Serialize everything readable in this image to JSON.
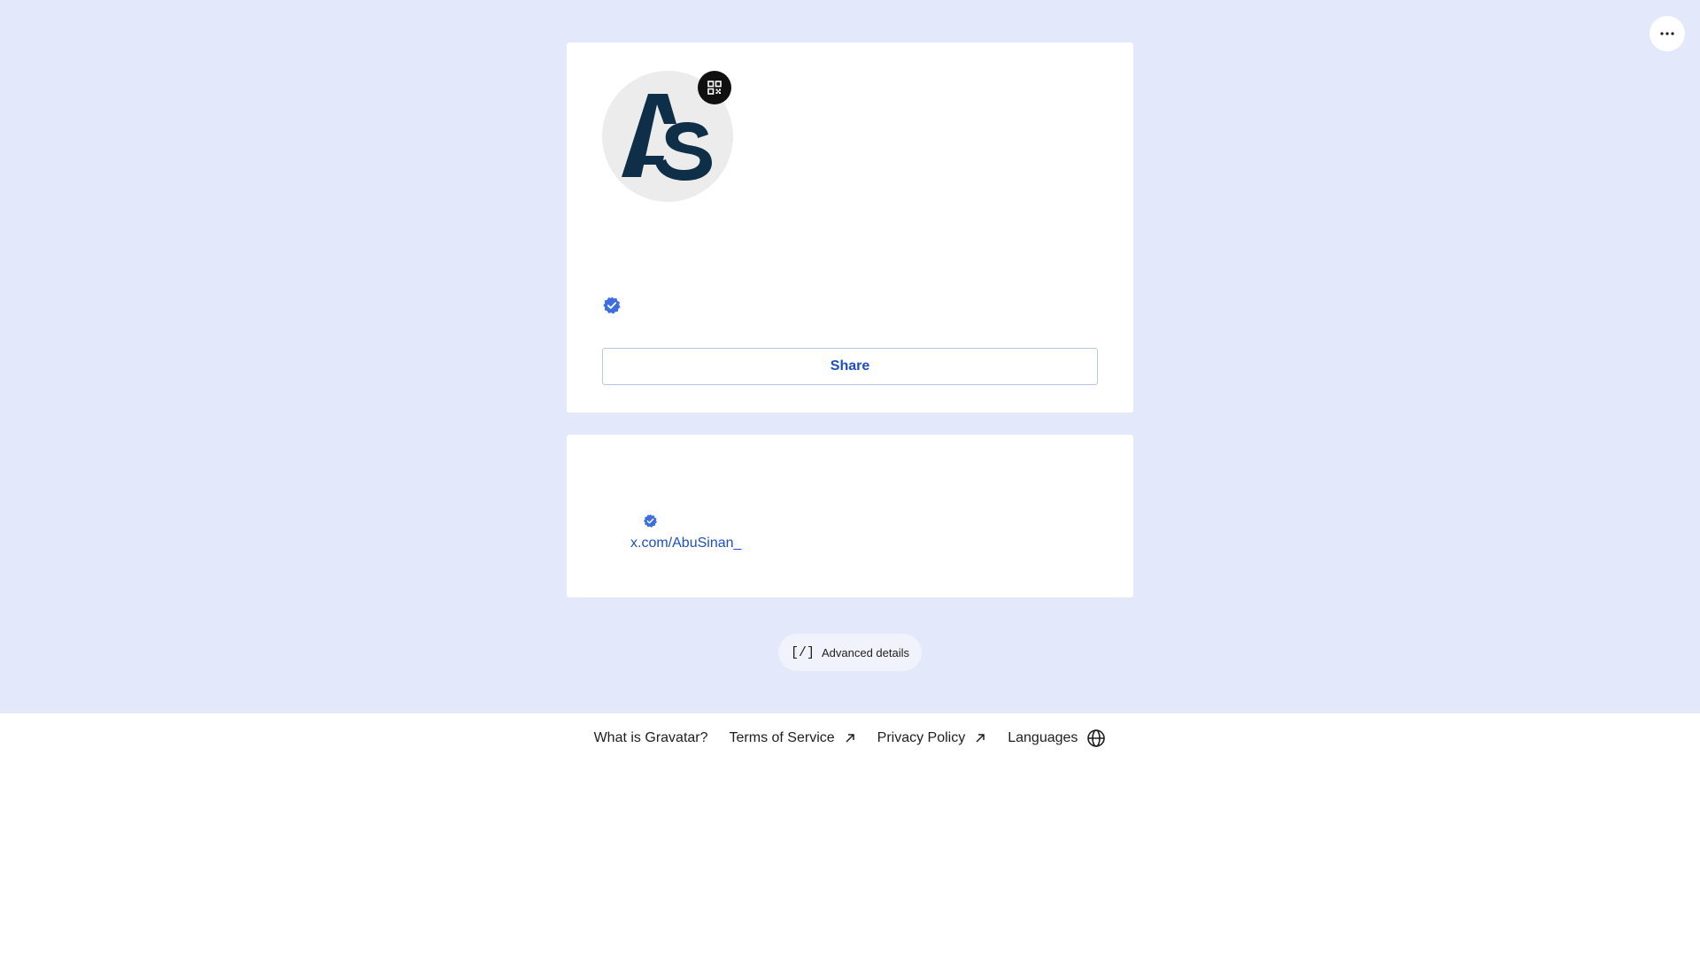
{
  "header": {
    "more_icon": "more-horizontal-icon"
  },
  "profile": {
    "avatar_icon": "avatar-logo-as",
    "qr_icon": "qr-code-icon",
    "verified_icon": "verified-badge-icon",
    "share_label": "Share"
  },
  "accounts": {
    "items": [
      {
        "verified_icon": "verified-badge-icon",
        "link": "x.com/AbuSinan_"
      }
    ]
  },
  "advanced": {
    "icon_text": "[/]",
    "label": "Advanced details"
  },
  "footer": {
    "links": [
      {
        "label": "What is Gravatar?",
        "icon": ""
      },
      {
        "label": "Terms of Service",
        "icon": "external-arrow-icon"
      },
      {
        "label": "Privacy Policy",
        "icon": "external-arrow-icon"
      },
      {
        "label": "Languages",
        "icon": "globe-icon"
      }
    ]
  },
  "colors": {
    "page_bg": "#e3e9fa",
    "card_bg": "#ffffff",
    "accent": "#1d4fc4",
    "verified": "#3d6ee0",
    "logo": "#0f2e47"
  }
}
